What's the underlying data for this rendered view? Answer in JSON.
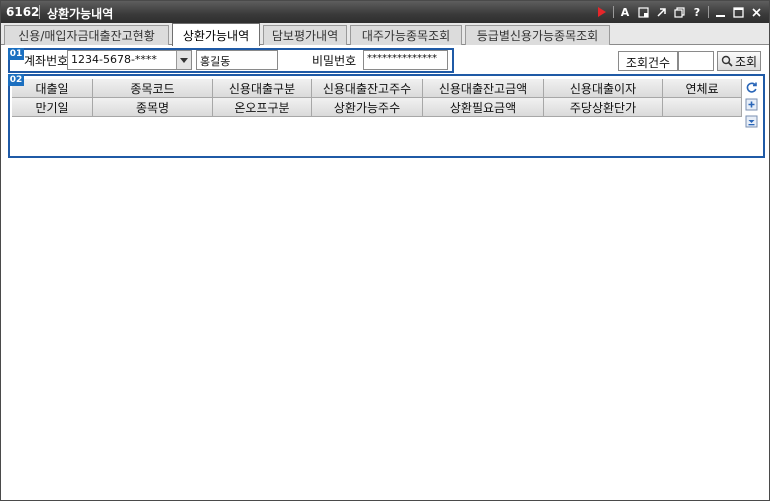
{
  "window": {
    "code": "6162",
    "title": "상환가능내역"
  },
  "titlebar_icons": [
    "play-icon",
    "font-icon",
    "capture-icon",
    "popout-icon",
    "restore-icon",
    "help-icon",
    "minimize-icon",
    "maximize-icon",
    "close-icon"
  ],
  "tabs": [
    {
      "label": "신용/매입자금대출잔고현황",
      "active": false
    },
    {
      "label": "상환가능내역",
      "active": true
    },
    {
      "label": "담보평가내역",
      "active": false
    },
    {
      "label": "대주가능종목조회",
      "active": false
    },
    {
      "label": "등급별신용가능종목조회",
      "active": false
    }
  ],
  "markers": {
    "section1": "01",
    "section2": "02"
  },
  "account": {
    "label": "계좌번호",
    "number": "1234-5678-****",
    "name": "홍길동",
    "password_label": "비밀번호",
    "password": "**************"
  },
  "query": {
    "count_label": "조회건수",
    "count_value": "",
    "button_label": "조회"
  },
  "grid": {
    "header_row1": [
      "대출일",
      "종목코드",
      "신용대출구분",
      "신용대출잔고주수",
      "신용대출잔고금액",
      "신용대출이자",
      "연체료"
    ],
    "header_row2": [
      "만기일",
      "종목명",
      "온오프구분",
      "상환가능주수",
      "상환필요금액",
      "주당상환단가",
      ""
    ]
  },
  "colors": {
    "accent_blue": "#1f5aa6",
    "marker_blue": "#1b6fc0",
    "title_bg": "#3a3a3a"
  }
}
